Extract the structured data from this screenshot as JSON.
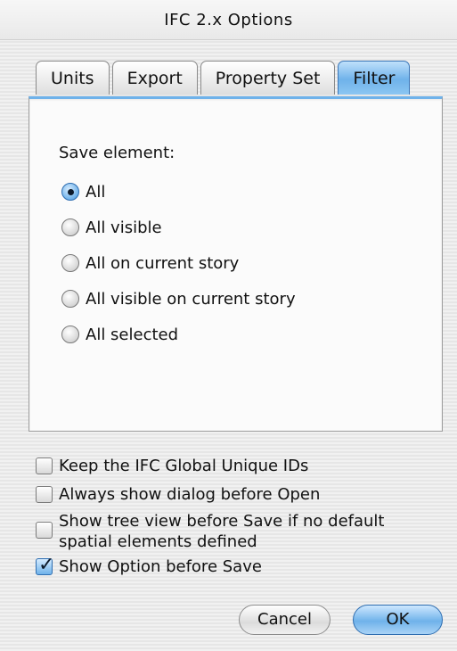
{
  "window": {
    "title": "IFC 2.x Options"
  },
  "tabs": [
    {
      "label": "Units",
      "active": false
    },
    {
      "label": "Export",
      "active": false
    },
    {
      "label": "Property Set",
      "active": false
    },
    {
      "label": "Filter",
      "active": true
    }
  ],
  "filter": {
    "section_label": "Save element:",
    "options": [
      {
        "label": "All",
        "selected": true
      },
      {
        "label": "All visible",
        "selected": false
      },
      {
        "label": "All on current story",
        "selected": false
      },
      {
        "label": "All visible on current story",
        "selected": false
      },
      {
        "label": "All selected",
        "selected": false
      }
    ]
  },
  "checkboxes": [
    {
      "label": "Keep the IFC Global Unique IDs",
      "checked": false
    },
    {
      "label": "Always show dialog before Open",
      "checked": false
    },
    {
      "label_line1": "Show tree view before Save if no default",
      "label_line2": "spatial elements defined",
      "checked": false
    },
    {
      "label": "Show Option before Save",
      "checked": true
    }
  ],
  "buttons": {
    "cancel": "Cancel",
    "ok": "OK"
  },
  "colors": {
    "accent": "#6fb2ea",
    "accent_border": "#3b76b8"
  }
}
